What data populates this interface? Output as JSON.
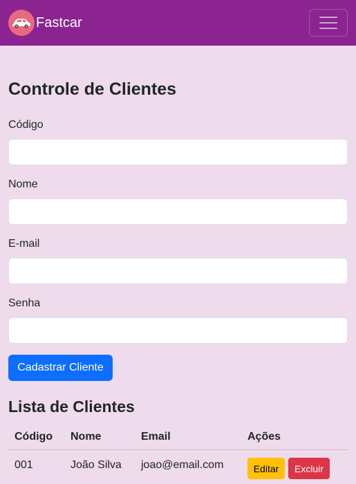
{
  "navbar": {
    "brand_name": "Fastcar",
    "brand_color": "#8b2491",
    "logo_icon": "car-icon",
    "menu_icon": "hamburger-menu-icon"
  },
  "form": {
    "title": "Controle de Clientes",
    "fields": [
      {
        "label": "Código",
        "value": ""
      },
      {
        "label": "Nome",
        "value": ""
      },
      {
        "label": "E-mail",
        "value": ""
      },
      {
        "label": "Senha",
        "value": ""
      }
    ],
    "submit_label": "Cadastrar Cliente",
    "submit_color": "#0d6efd"
  },
  "list": {
    "title": "Lista de Clientes",
    "columns": [
      "Código",
      "Nome",
      "Email",
      "Ações"
    ],
    "rows": [
      {
        "codigo": "001",
        "nome": "João Silva",
        "email": "joao@email.com",
        "edit_label": "Editar",
        "delete_label": "Excluir"
      }
    ],
    "edit_color": "#ffc107",
    "delete_color": "#dc3545"
  }
}
